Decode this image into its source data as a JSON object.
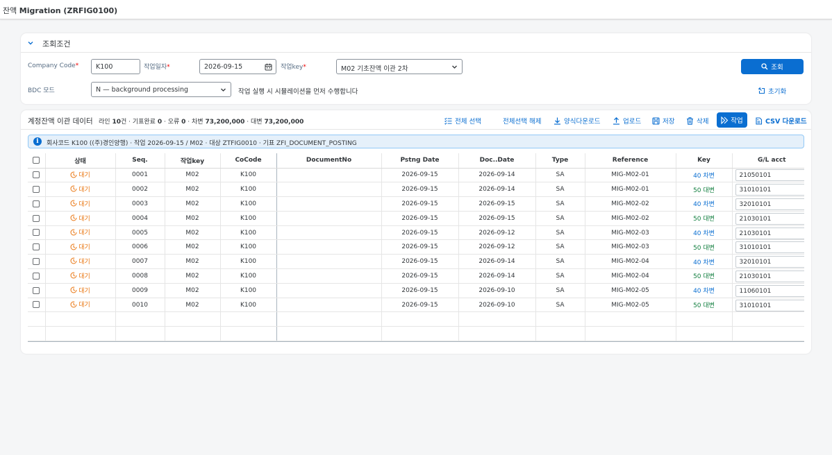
{
  "app": {
    "title_prefix": "잔액",
    "title_main": "Migration (ZRFIG0100)"
  },
  "filter": {
    "header": "조회조건",
    "company_code_label": "Company Code",
    "company_code_value": "K100",
    "work_date_label": "작업일자",
    "work_date_value": "2026-09-15",
    "work_key_label": "작업key",
    "work_key_value": "M02 기초잔액 이관 2차",
    "bdc_label": "BDC 모드",
    "bdc_value": "N — background processing",
    "note": "작업 실행 시 시뮬레이션을 먼저 수행합니다",
    "search_button": "조회",
    "reset_link": "초기화",
    "required_mark": "*"
  },
  "table_header": {
    "title": "계정잔액 이관 데이터",
    "summary": {
      "lines_label": "라인",
      "lines_value": "10",
      "lines_unit": "건 · 기표완료",
      "done_value": "0",
      "error_label": "· 오류",
      "error_value": "0",
      "debit_label": "· 차변",
      "debit_value": "73,200,000",
      "credit_label": "· 대변",
      "credit_value": "73,200,000"
    },
    "tools": {
      "select_all": "전체 선택",
      "deselect_all": "전체선택 해제",
      "template_download": "양식다운로드",
      "upload": "업로드",
      "save": "저장",
      "delete": "삭제",
      "execute": "작업",
      "csv_download": "CSV 다운로드"
    }
  },
  "info_bar": {
    "text": "회사코드 K100 ((주)경인양행) · 작업 2026-09-15 / M02 · 대상 ZTFIG0010 · 기표 ZFI_DOCUMENT_POSTING"
  },
  "columns": [
    "상태",
    "Seq.",
    "작업key",
    "CoCode",
    "DocumentNo",
    "Pstng Date",
    "Doc..Date",
    "Type",
    "Reference",
    "Key",
    "G/L acct"
  ],
  "rows": [
    {
      "status": "대기",
      "seq": "0001",
      "work_key": "M02",
      "cocode": "K100",
      "doc_no": "",
      "pstng_date": "2026-09-15",
      "doc_date": "2026-09-14",
      "type": "SA",
      "reference": "MIG-M02-01",
      "key": "40 차변",
      "key_kind": "debit",
      "gl": "21050101"
    },
    {
      "status": "대기",
      "seq": "0002",
      "work_key": "M02",
      "cocode": "K100",
      "doc_no": "",
      "pstng_date": "2026-09-15",
      "doc_date": "2026-09-14",
      "type": "SA",
      "reference": "MIG-M02-01",
      "key": "50 대변",
      "key_kind": "credit",
      "gl": "31010101"
    },
    {
      "status": "대기",
      "seq": "0003",
      "work_key": "M02",
      "cocode": "K100",
      "doc_no": "",
      "pstng_date": "2026-09-15",
      "doc_date": "2026-09-15",
      "type": "SA",
      "reference": "MIG-M02-02",
      "key": "40 차변",
      "key_kind": "debit",
      "gl": "32010101"
    },
    {
      "status": "대기",
      "seq": "0004",
      "work_key": "M02",
      "cocode": "K100",
      "doc_no": "",
      "pstng_date": "2026-09-15",
      "doc_date": "2026-09-15",
      "type": "SA",
      "reference": "MIG-M02-02",
      "key": "50 대변",
      "key_kind": "credit",
      "gl": "21030101"
    },
    {
      "status": "대기",
      "seq": "0005",
      "work_key": "M02",
      "cocode": "K100",
      "doc_no": "",
      "pstng_date": "2026-09-15",
      "doc_date": "2026-09-12",
      "type": "SA",
      "reference": "MIG-M02-03",
      "key": "40 차변",
      "key_kind": "debit",
      "gl": "21030101"
    },
    {
      "status": "대기",
      "seq": "0006",
      "work_key": "M02",
      "cocode": "K100",
      "doc_no": "",
      "pstng_date": "2026-09-15",
      "doc_date": "2026-09-12",
      "type": "SA",
      "reference": "MIG-M02-03",
      "key": "50 대변",
      "key_kind": "credit",
      "gl": "31010101"
    },
    {
      "status": "대기",
      "seq": "0007",
      "work_key": "M02",
      "cocode": "K100",
      "doc_no": "",
      "pstng_date": "2026-09-15",
      "doc_date": "2026-09-14",
      "type": "SA",
      "reference": "MIG-M02-04",
      "key": "40 차변",
      "key_kind": "debit",
      "gl": "32010101"
    },
    {
      "status": "대기",
      "seq": "0008",
      "work_key": "M02",
      "cocode": "K100",
      "doc_no": "",
      "pstng_date": "2026-09-15",
      "doc_date": "2026-09-14",
      "type": "SA",
      "reference": "MIG-M02-04",
      "key": "50 대변",
      "key_kind": "credit",
      "gl": "21030101"
    },
    {
      "status": "대기",
      "seq": "0009",
      "work_key": "M02",
      "cocode": "K100",
      "doc_no": "",
      "pstng_date": "2026-09-15",
      "doc_date": "2026-09-10",
      "type": "SA",
      "reference": "MIG-M02-05",
      "key": "40 차변",
      "key_kind": "debit",
      "gl": "11060101"
    },
    {
      "status": "대기",
      "seq": "0010",
      "work_key": "M02",
      "cocode": "K100",
      "doc_no": "",
      "pstng_date": "2026-09-15",
      "doc_date": "2026-09-10",
      "type": "SA",
      "reference": "MIG-M02-05",
      "key": "50 대변",
      "key_kind": "credit",
      "gl": "31010101"
    }
  ],
  "colors": {
    "accent": "#0a6ed1",
    "status_waiting": "#e9730c",
    "debit": "#0a6ed1",
    "credit": "#107e3e"
  }
}
